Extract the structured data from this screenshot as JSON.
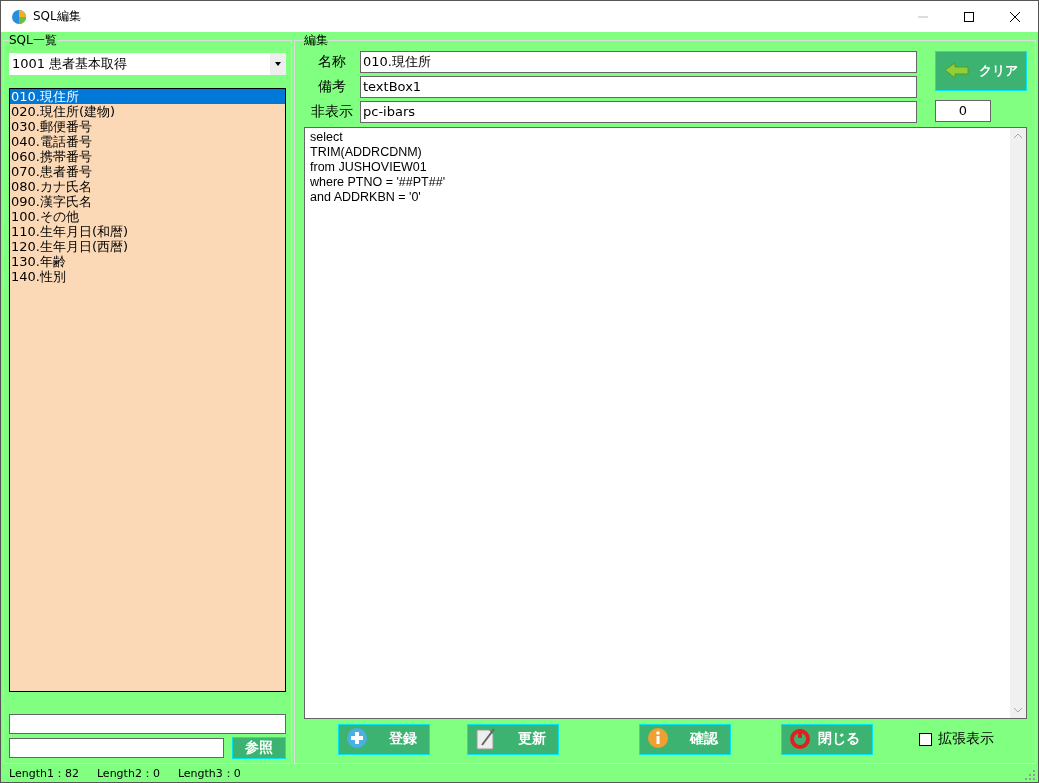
{
  "window": {
    "title": "SQL編集"
  },
  "sql_list": {
    "title": "SQL一覧",
    "dropdown": "1001  患者基本取得",
    "items": [
      {
        "label": "010.現住所",
        "selected": true
      },
      {
        "label": "020.現住所(建物)",
        "selected": false
      },
      {
        "label": "030.郵便番号",
        "selected": false
      },
      {
        "label": "040.電話番号",
        "selected": false
      },
      {
        "label": "060.携帯番号",
        "selected": false
      },
      {
        "label": "070.患者番号",
        "selected": false
      },
      {
        "label": "080.カナ氏名",
        "selected": false
      },
      {
        "label": "090.漢字氏名",
        "selected": false
      },
      {
        "label": "100.その他",
        "selected": false
      },
      {
        "label": "110.生年月日(和暦)",
        "selected": false
      },
      {
        "label": "120.生年月日(西暦)",
        "selected": false
      },
      {
        "label": "130.年齢",
        "selected": false
      },
      {
        "label": "140.性別",
        "selected": false
      }
    ],
    "browse_button": "参照"
  },
  "edit": {
    "title": "編集",
    "fields": [
      {
        "label": "名称",
        "value": "010.現住所"
      },
      {
        "label": "備考",
        "value": "textBox1"
      },
      {
        "label": "非表示",
        "value": "pc-ibars"
      }
    ],
    "clear_button": "クリア",
    "counter": "0",
    "sql_lines": [
      "select",
      "TRIM(ADDRCDNM)",
      "from JUSHOVIEW01",
      "where PTNO = '##PT##'",
      "and ADDRKBN = '0'"
    ],
    "buttons": [
      {
        "kind": "add",
        "label": "登録"
      },
      {
        "kind": "edit",
        "label": "更新"
      },
      {
        "kind": "info",
        "label": "確認"
      },
      {
        "kind": "power",
        "label": "閉じる"
      }
    ],
    "extended_view": {
      "label": "拡張表示",
      "checked": false
    }
  },
  "status_bar": [
    "Length1：82",
    "Length2：0",
    "Length3：0"
  ]
}
